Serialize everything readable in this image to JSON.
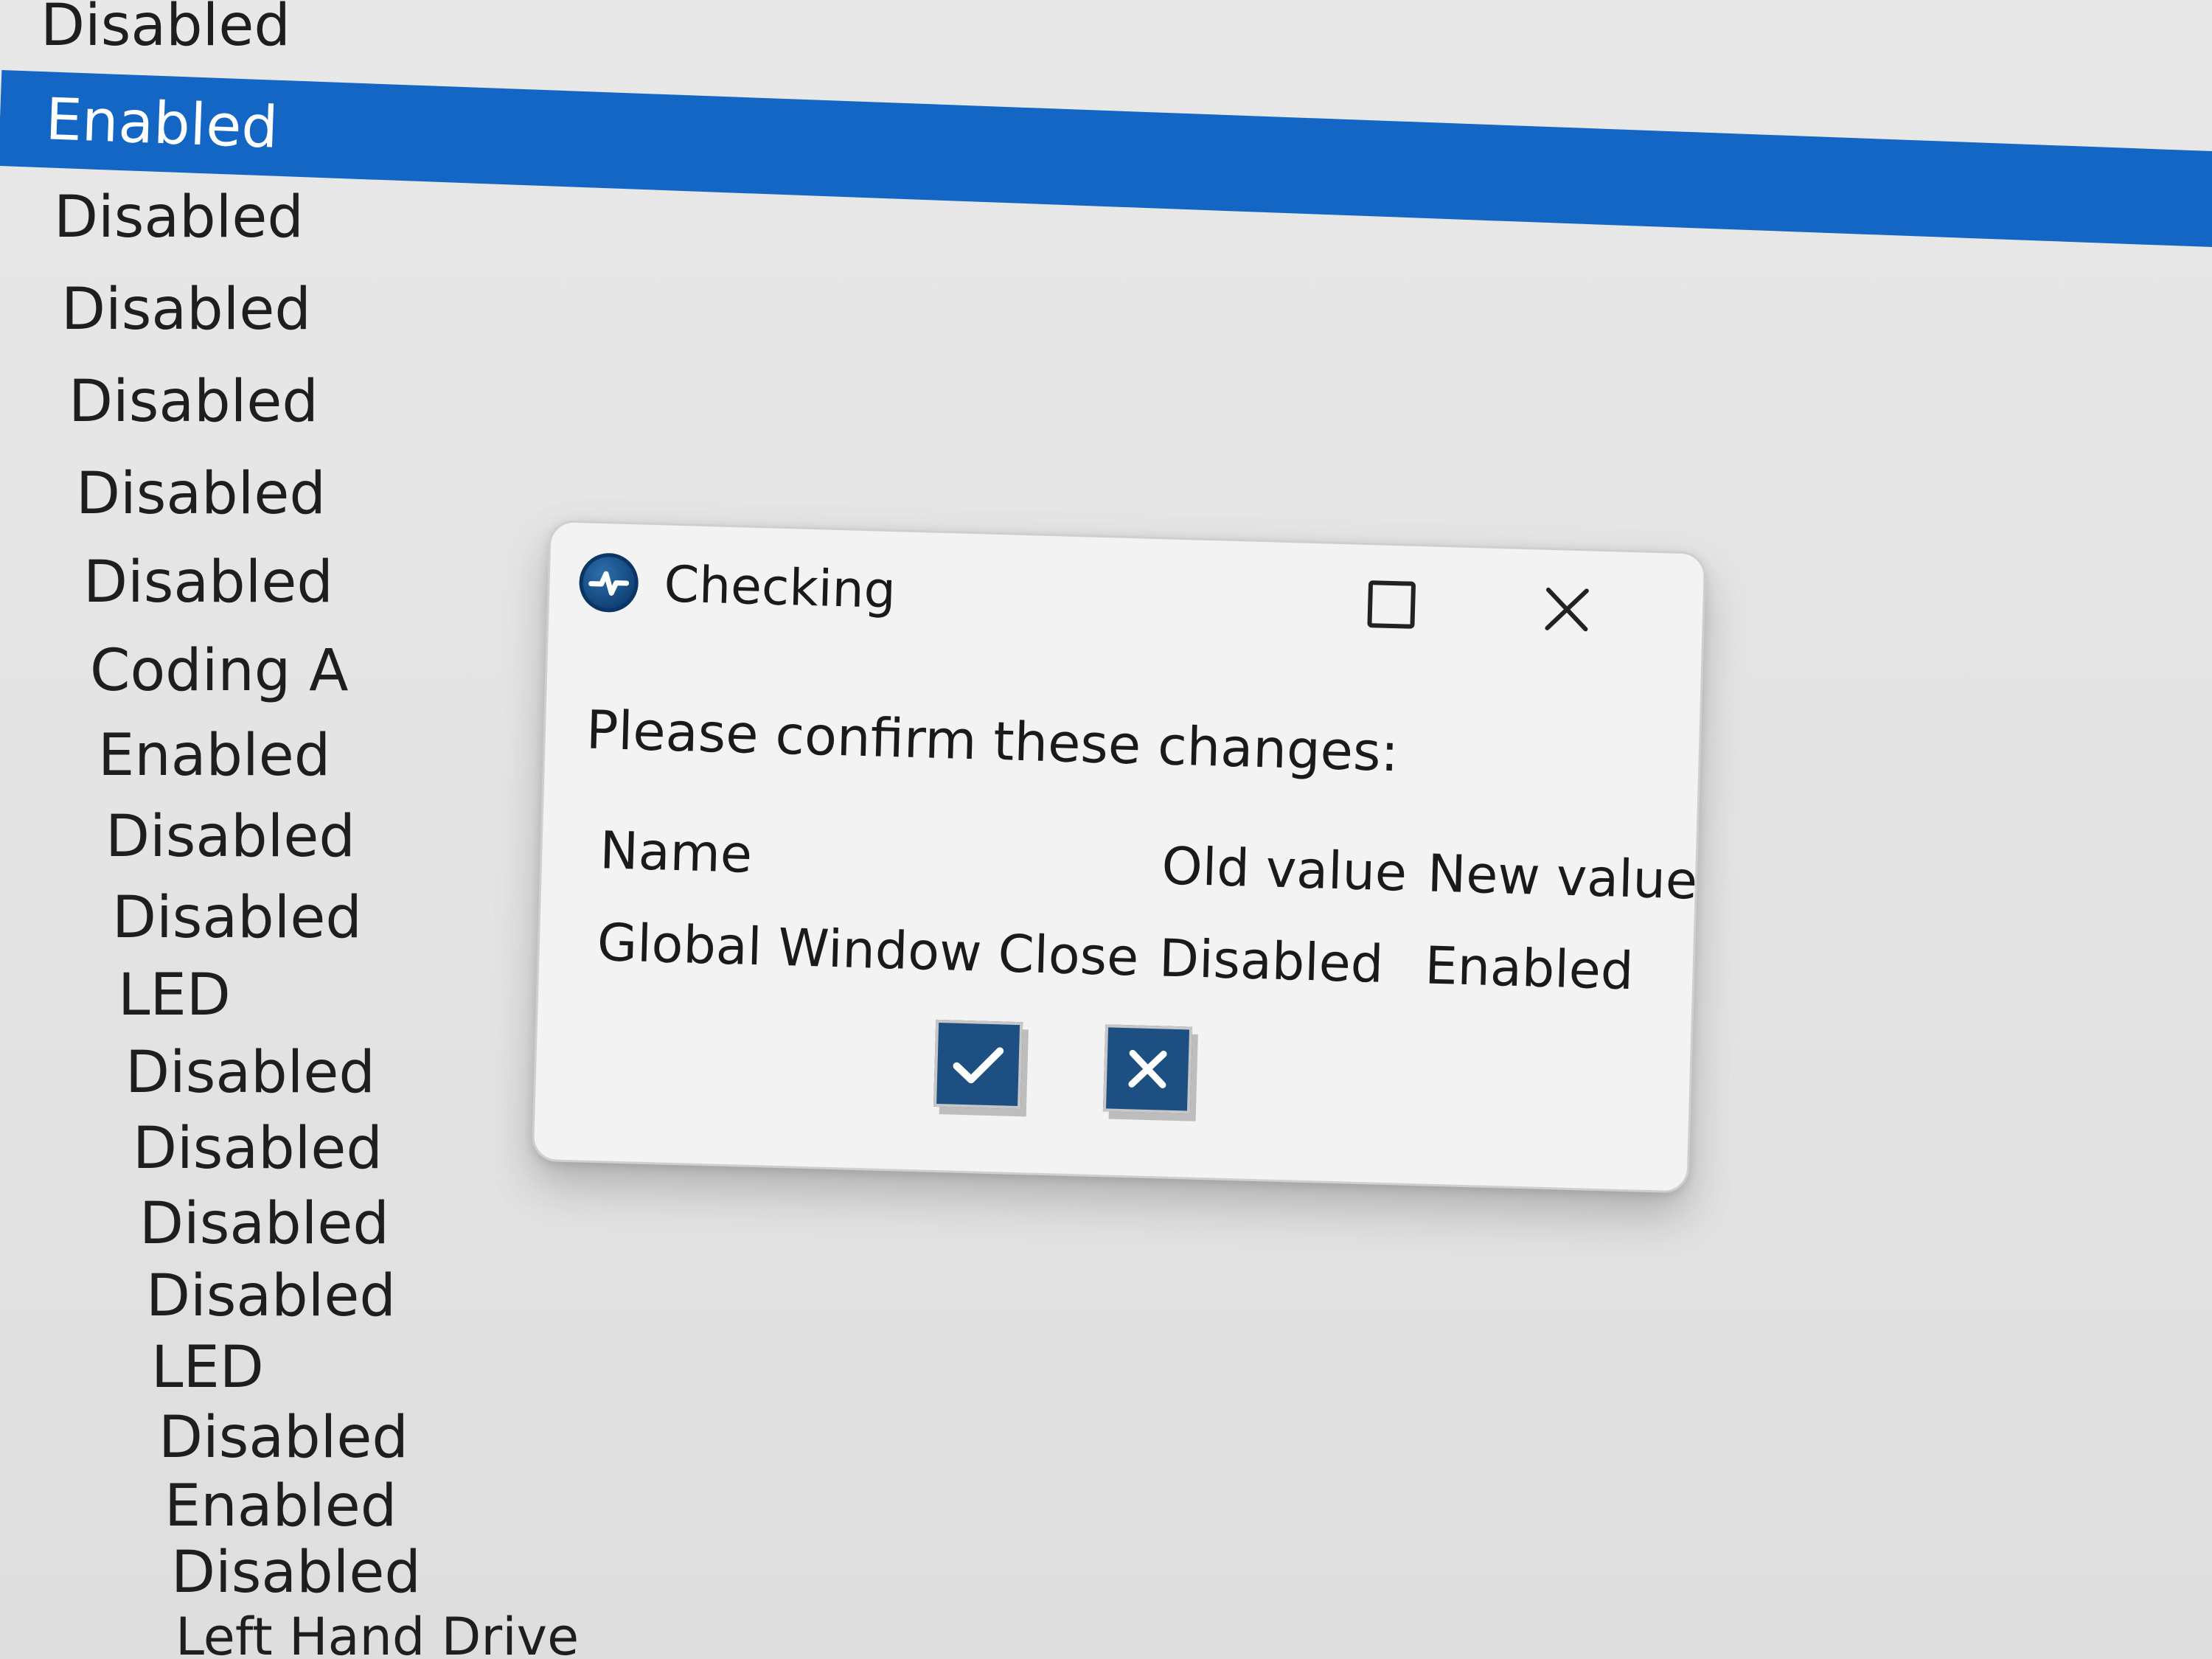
{
  "background_list": {
    "rows": [
      "Disabled",
      "Enabled",
      "Disabled",
      "Disabled",
      "Disabled",
      "Disabled",
      "Disabled",
      "Coding A",
      "Enabled",
      "Disabled",
      "Disabled",
      "LED",
      "Disabled",
      "Disabled",
      "Disabled",
      "Disabled",
      "LED",
      "Disabled",
      "Enabled",
      "Disabled",
      "Left Hand Drive"
    ],
    "selected_index": 1,
    "selection_color": "#1466c5"
  },
  "dialog": {
    "title": "Checking",
    "app_icon": "app-logo-icon",
    "maximize_icon": "maximize-icon",
    "close_icon": "close-icon",
    "message": "Please confirm these changes:",
    "table": {
      "headers": [
        "Name",
        "Old value",
        "New value"
      ],
      "rows": [
        [
          "Global Window Close",
          "Disabled",
          "Enabled"
        ]
      ]
    },
    "confirm_icon": "checkmark-icon",
    "cancel_icon": "cross-icon",
    "button_color": "#1d4f82"
  }
}
